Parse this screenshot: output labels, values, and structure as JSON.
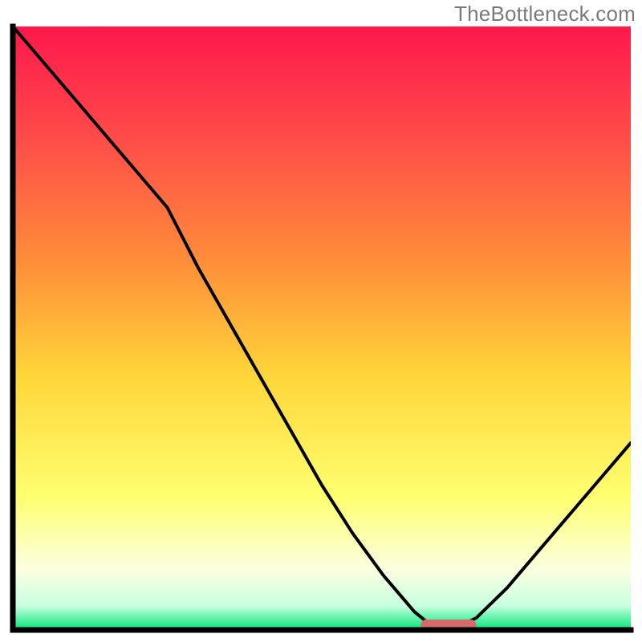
{
  "watermark": "TheBottleneck.com",
  "colors": {
    "gradient_top": "#ff184c",
    "gradient_mid_upper": "#ff8a3a",
    "gradient_mid": "#ffd63a",
    "gradient_low_yellow": "#ffff70",
    "gradient_cream": "#fbffe0",
    "gradient_green": "#00e676",
    "curve": "#000000",
    "marker": "#d66a6a",
    "frame": "#000000",
    "bg": "#ffffff"
  },
  "chart_data": {
    "type": "line",
    "title": "",
    "xlabel": "",
    "ylabel": "",
    "xlim": [
      0,
      100
    ],
    "ylim": [
      0,
      100
    ],
    "x": [
      0,
      5,
      10,
      15,
      20,
      25,
      30,
      35,
      40,
      45,
      50,
      55,
      60,
      65,
      68,
      72,
      75,
      80,
      85,
      90,
      95,
      100
    ],
    "values": [
      100,
      94,
      88,
      82,
      76,
      70,
      60,
      51,
      42,
      33,
      24,
      16,
      9,
      3,
      0.5,
      0.5,
      2,
      7,
      13,
      19,
      25,
      31
    ],
    "marker": {
      "x_start": 66,
      "x_end": 75,
      "y": 0.8
    },
    "notes": "y reads as percent-like magnitude (0 bottom, 100 top). Curve drops roughly linearly, flattens near the bottom around x≈66–75, then rises again."
  }
}
